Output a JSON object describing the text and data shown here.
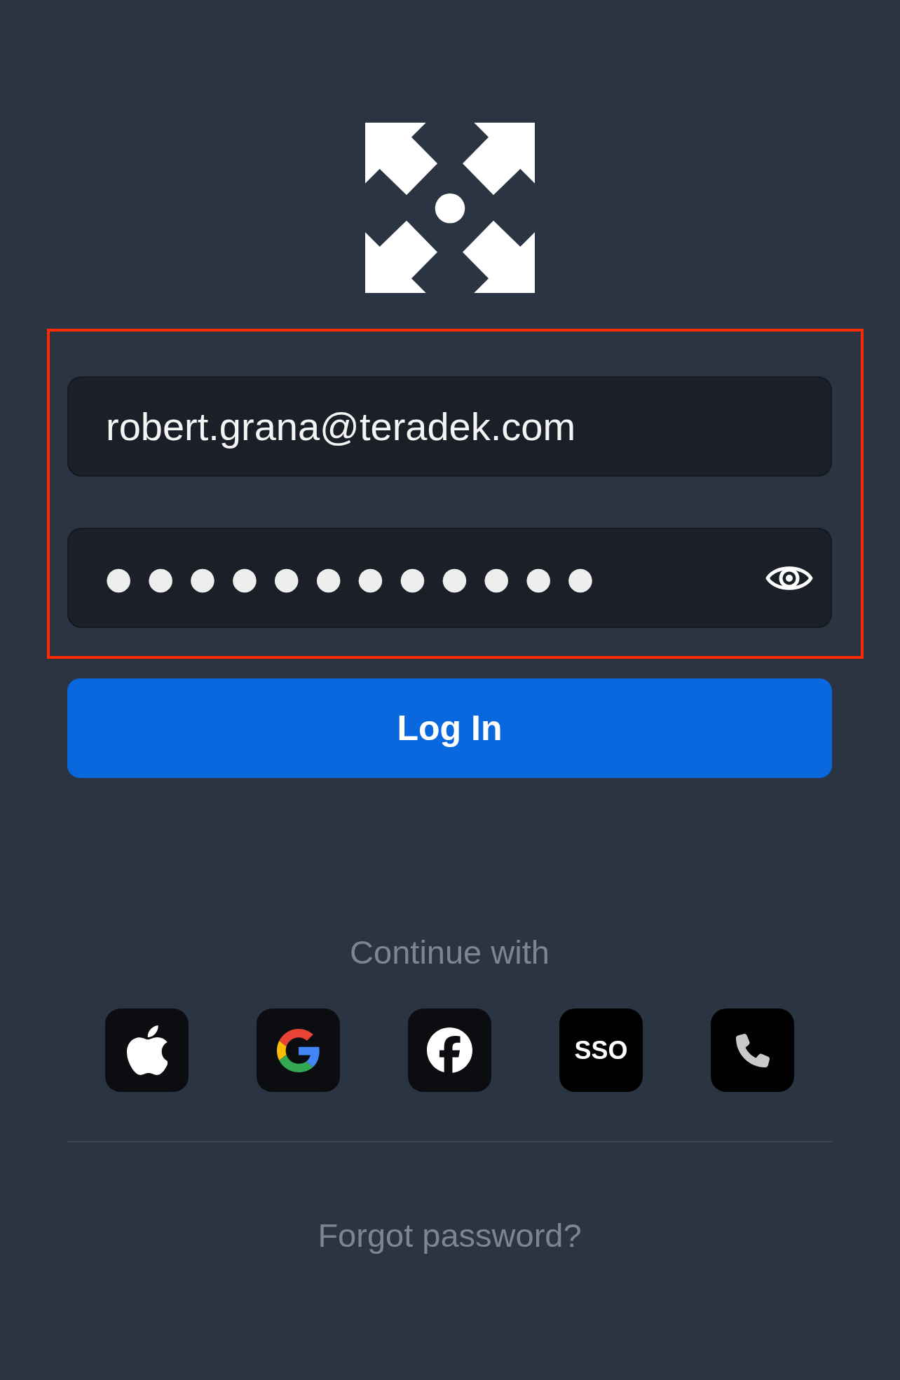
{
  "login_form": {
    "highlighted": true,
    "email_field": {
      "value": "robert.grana@teradek.com"
    },
    "password_field": {
      "masked_value": "●●●●●●●●●●●●"
    }
  },
  "login_button": {
    "label": "Log In"
  },
  "continue_with": {
    "label": "Continue with"
  },
  "social_buttons": [
    {
      "kind": "apple"
    },
    {
      "kind": "google"
    },
    {
      "kind": "facebook"
    },
    {
      "kind": "sso",
      "label": "SSO"
    },
    {
      "kind": "phone"
    }
  ],
  "forgot_password_link": {
    "label": "Forgot password?"
  }
}
